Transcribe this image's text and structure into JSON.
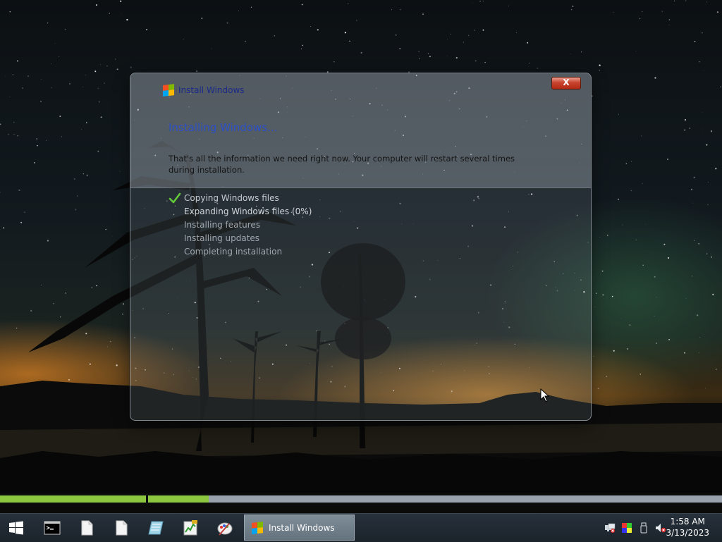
{
  "desktop": {
    "wallpaper": "night-sky-lake-trees"
  },
  "window": {
    "title": "Install Windows",
    "close_label": "X",
    "heading": "Installing Windows...",
    "info": "That's all the information we need right now. Your computer will restart several times during installation.",
    "steps": [
      {
        "label": "Copying Windows files",
        "state": "done"
      },
      {
        "label": "Expanding Windows files (0%)",
        "state": "active"
      },
      {
        "label": "Installing features",
        "state": "pending"
      },
      {
        "label": "Installing updates",
        "state": "pending"
      },
      {
        "label": "Completing installation",
        "state": "pending"
      }
    ]
  },
  "progress": {
    "segments": [
      {
        "fraction": 1.0
      },
      {
        "fraction": 0.106
      }
    ],
    "fill_color": "#8dc63f",
    "track_color": "#9aa3ad"
  },
  "taskbar": {
    "start_icon": "windows-start-icon",
    "pinned": [
      "command-prompt-icon",
      "document-icon",
      "document-icon",
      "notepad-icon",
      "task-manager-icon",
      "paint-icon"
    ],
    "active_task": {
      "label": "Install Windows",
      "icon": "windows-flag-icon"
    },
    "tray": [
      "network-icon",
      "display-icon",
      "usb-drive-icon",
      "volume-muted-icon"
    ],
    "clock": {
      "time": "1:58 AM",
      "date": "3/13/2023"
    }
  },
  "colors": {
    "title_text": "#1a2a8a",
    "heading_text": "#2b4fc8",
    "close_red": "#c8432e",
    "check_green": "#63c93a"
  }
}
